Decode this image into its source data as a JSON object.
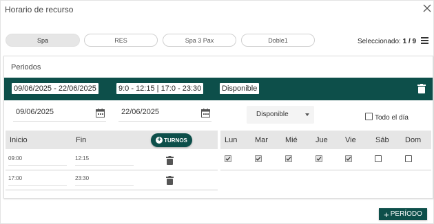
{
  "dialog": {
    "title": "Horario de recurso"
  },
  "resources": {
    "pills": [
      "Spa",
      "RES",
      "Spa 3 Pax",
      "Doble1"
    ],
    "active_index": 0
  },
  "selection": {
    "label": "Seleccionado:",
    "value": "1 / 9"
  },
  "periods": {
    "title": "Periodos",
    "summary": {
      "dates": "09/06/2025 - 22/06/2025",
      "times": "9:0 - 12:15 | 17:0 - 23:30",
      "status": "Disponible"
    },
    "start_date": "09/06/2025",
    "end_date": "22/06/2025",
    "availability": "Disponible",
    "all_day_label": "Todo el día",
    "all_day": false,
    "columns": {
      "start": "Inicio",
      "end": "Fin"
    },
    "turnos_label": "TURNOS",
    "shifts": [
      {
        "start": "09:00",
        "end": "12:15"
      },
      {
        "start": "17:00",
        "end": "23:30"
      }
    ],
    "days": [
      {
        "label": "Lun",
        "checked": true
      },
      {
        "label": "Mar",
        "checked": true
      },
      {
        "label": "Mié",
        "checked": true
      },
      {
        "label": "Jue",
        "checked": true
      },
      {
        "label": "Vie",
        "checked": true
      },
      {
        "label": "Sáb",
        "checked": false
      },
      {
        "label": "Dom",
        "checked": false
      }
    ]
  },
  "footer": {
    "add_period_label": "PERÍODO"
  },
  "colors": {
    "accent": "#0d4f4a"
  }
}
